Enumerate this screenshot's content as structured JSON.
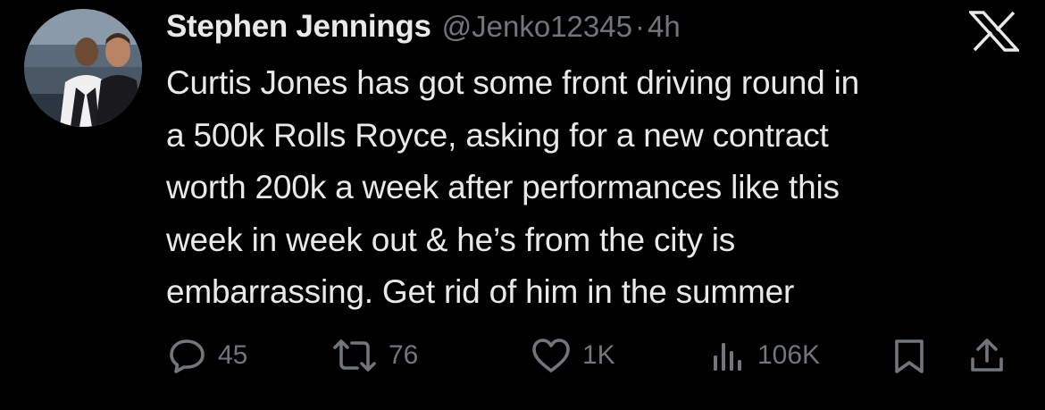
{
  "author": {
    "display_name": "Stephen Jennings",
    "handle": "@Jenko12345",
    "separator": "·",
    "time_ago": "4h"
  },
  "tweet": {
    "text": "Curtis Jones has got some front driving round in\na 500k Rolls Royce, asking for a new contract\nworth 200k a week after performances like this\nweek in week out & he’s from the city is\nembarrassing. Get rid of him in the summer"
  },
  "actions": {
    "replies": "45",
    "reposts": "76",
    "likes": "1K",
    "views": "106K"
  },
  "icons": {
    "brand": "x-logo-icon",
    "reply": "reply-icon",
    "repost": "repost-icon",
    "like": "heart-icon",
    "views": "views-bar-icon",
    "bookmark": "bookmark-icon",
    "share": "share-icon"
  },
  "colors": {
    "background": "#000000",
    "primary_text": "#e7e9ea",
    "secondary_text": "#71767b"
  }
}
